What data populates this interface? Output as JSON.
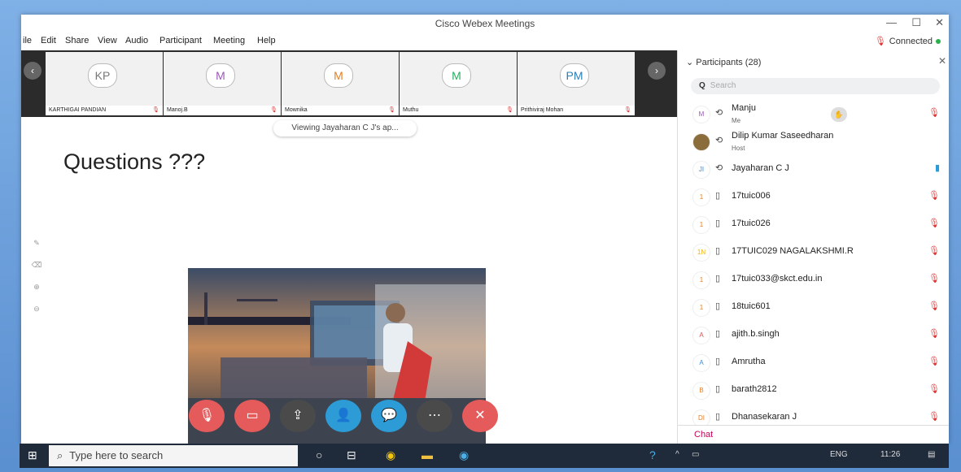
{
  "window": {
    "title": "Cisco Webex Meetings"
  },
  "menu": [
    "ile",
    "Edit",
    "Share",
    "View",
    "Audio",
    "Participant",
    "Meeting",
    "Help"
  ],
  "status": {
    "connected": "Connected"
  },
  "thumbs": [
    {
      "initials": "KP",
      "name": "KARTHIGAI PANDIAN",
      "color": "#777"
    },
    {
      "initials": "M",
      "name": "Manoj.B",
      "color": "#9b59b6"
    },
    {
      "initials": "M",
      "name": "Mownika",
      "color": "#e67e22"
    },
    {
      "initials": "M",
      "name": "Muthu",
      "color": "#27ae60"
    },
    {
      "initials": "PM",
      "name": "Prithiviraj Mohan",
      "color": "#2980b9"
    }
  ],
  "share": {
    "viewing": "Viewing Jayaharan C J's ap...",
    "slide_title": "Questions ???"
  },
  "participants": {
    "header": "Participants (28)",
    "search_placeholder": "Search",
    "rows": [
      {
        "initials": "M",
        "name": "Manju",
        "role": "Me",
        "color": "#9b59b6"
      },
      {
        "initials": "",
        "name": "Dilip Kumar Saseedharan",
        "role": "Host",
        "color": "#8a6d3b"
      },
      {
        "initials": "JI",
        "name": "Jayaharan C J",
        "role": "",
        "color": "#3a8dde"
      },
      {
        "initials": "1",
        "name": "17tuic006",
        "role": "",
        "color": "#e67e22"
      },
      {
        "initials": "1",
        "name": "17tuic026",
        "role": "",
        "color": "#e67e22"
      },
      {
        "initials": "1N",
        "name": "17TUIC029 NAGALAKSHMI.R",
        "role": "",
        "color": "#f0b400"
      },
      {
        "initials": "1",
        "name": "17tuic033@skct.edu.in",
        "role": "",
        "color": "#e67e22"
      },
      {
        "initials": "1",
        "name": "18tuic601",
        "role": "",
        "color": "#e67e22"
      },
      {
        "initials": "A",
        "name": "ajith.b.singh",
        "role": "",
        "color": "#d9534f"
      },
      {
        "initials": "A",
        "name": "Amrutha",
        "role": "",
        "color": "#3a8dde"
      },
      {
        "initials": "B",
        "name": "barath2812",
        "role": "",
        "color": "#e67e22"
      },
      {
        "initials": "DI",
        "name": "Dhanasekaran J",
        "role": "",
        "color": "#e67e22"
      }
    ],
    "chat": "Chat"
  },
  "taskbar": {
    "search": "Type here to search",
    "lang": "ENG",
    "time": "11:26"
  }
}
